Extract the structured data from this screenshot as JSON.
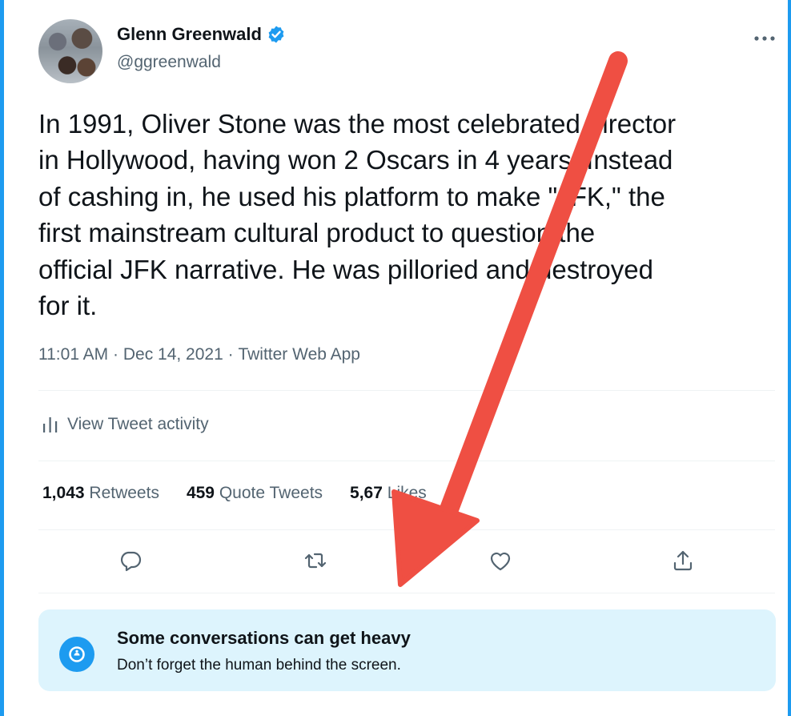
{
  "author": {
    "name": "Glenn Greenwald",
    "handle": "@ggreenwald",
    "verified": true
  },
  "tweet": {
    "text": "In 1991, Oliver Stone was the most celebrated director\nin Hollywood, having won 2 Oscars in 4 years. Instead\nof cashing in, he used his platform to make \"JFK,\" the\nfirst mainstream cultural product to question the\nofficial JFK narrative. He was pilloried and destroyed\nfor it.",
    "time": "11:01 AM",
    "date": "Dec 14, 2021",
    "source": "Twitter Web App",
    "separator": " · "
  },
  "activity": {
    "label": "View Tweet activity"
  },
  "stats": {
    "retweets_count": "1,043",
    "retweets_label": "Retweets",
    "quotes_count": "459",
    "quotes_label": "Quote Tweets",
    "likes_count": "5,67",
    "likes_label": "Likes"
  },
  "actions": [
    "reply-icon",
    "retweet-icon",
    "like-icon",
    "share-icon"
  ],
  "notice": {
    "title": "Some conversations can get heavy",
    "subtitle": "Don’t forget the human behind the screen."
  },
  "colors": {
    "accent": "#1d9bf0",
    "arrow": "#ef4f43",
    "notice_bg": "#ddf4fd",
    "secondary_text": "#536471"
  }
}
